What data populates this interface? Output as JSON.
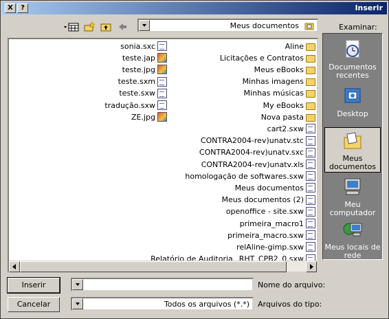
{
  "window": {
    "title": "Inserir",
    "help_glyph": "?",
    "close_glyph": "X"
  },
  "toolbar": {
    "look_in_label": "Examinar:",
    "look_in_value": "Meus documentos"
  },
  "places": [
    {
      "label": "Documentos recentes",
      "icon": "recent-documents-icon"
    },
    {
      "label": "Desktop",
      "icon": "desktop-icon"
    },
    {
      "label": "Meus documentos",
      "icon": "my-documents-icon"
    },
    {
      "label": "Meu computador",
      "icon": "my-computer-icon"
    },
    {
      "label": "Meus locais de rede",
      "icon": "network-places-icon"
    }
  ],
  "files_col1": [
    {
      "name": "Aline",
      "type": "folder"
    },
    {
      "name": "Licitações e Contratos",
      "type": "folder"
    },
    {
      "name": "Meus eBooks",
      "type": "folder"
    },
    {
      "name": "Minhas imagens",
      "type": "folder"
    },
    {
      "name": "Minhas músicas",
      "type": "folder"
    },
    {
      "name": "My eBooks",
      "type": "folder"
    },
    {
      "name": "Nova pasta",
      "type": "folder"
    },
    {
      "name": "cart2.sxw",
      "type": "doc"
    },
    {
      "name": "CONTRA2004-rev)unatv.stc",
      "type": "doc"
    },
    {
      "name": "CONTRA2004-rev)unatv.sxc",
      "type": "doc"
    },
    {
      "name": "CONTRA2004-rev)unatv.xls",
      "type": "doc"
    },
    {
      "name": "homologação de softwares.sxw",
      "type": "doc"
    },
    {
      "name": "Meus documentos",
      "type": "doc"
    },
    {
      "name": "Meus documentos (2)",
      "type": "doc"
    },
    {
      "name": "openoffice - site.sxw",
      "type": "doc"
    },
    {
      "name": "primeira_macro1",
      "type": "doc"
    },
    {
      "name": "primeira_macro.sxw",
      "type": "doc"
    },
    {
      "name": "relAline-gimp.sxw",
      "type": "doc"
    },
    {
      "name": "Relatório de Auditoria _RHT_CPB2_0.sxw",
      "type": "doc"
    }
  ],
  "files_col2": [
    {
      "name": "sonia.sxc",
      "type": "doc"
    },
    {
      "name": "teste.jap",
      "type": "img"
    },
    {
      "name": "teste.jpg",
      "type": "img"
    },
    {
      "name": "teste.sxm",
      "type": "doc"
    },
    {
      "name": "teste.sxw",
      "type": "doc"
    },
    {
      "name": "tradução.sxw",
      "type": "doc"
    },
    {
      "name": "ZE.jpg",
      "type": "img"
    }
  ],
  "form": {
    "filename_label": "Nome do arquivo:",
    "filename_value": "",
    "filetype_label": "Arquivos do tipo:",
    "filetype_value": "Todos os arquivos (*.*)",
    "ok_label": "Inserir",
    "cancel_label": "Cancelar"
  }
}
